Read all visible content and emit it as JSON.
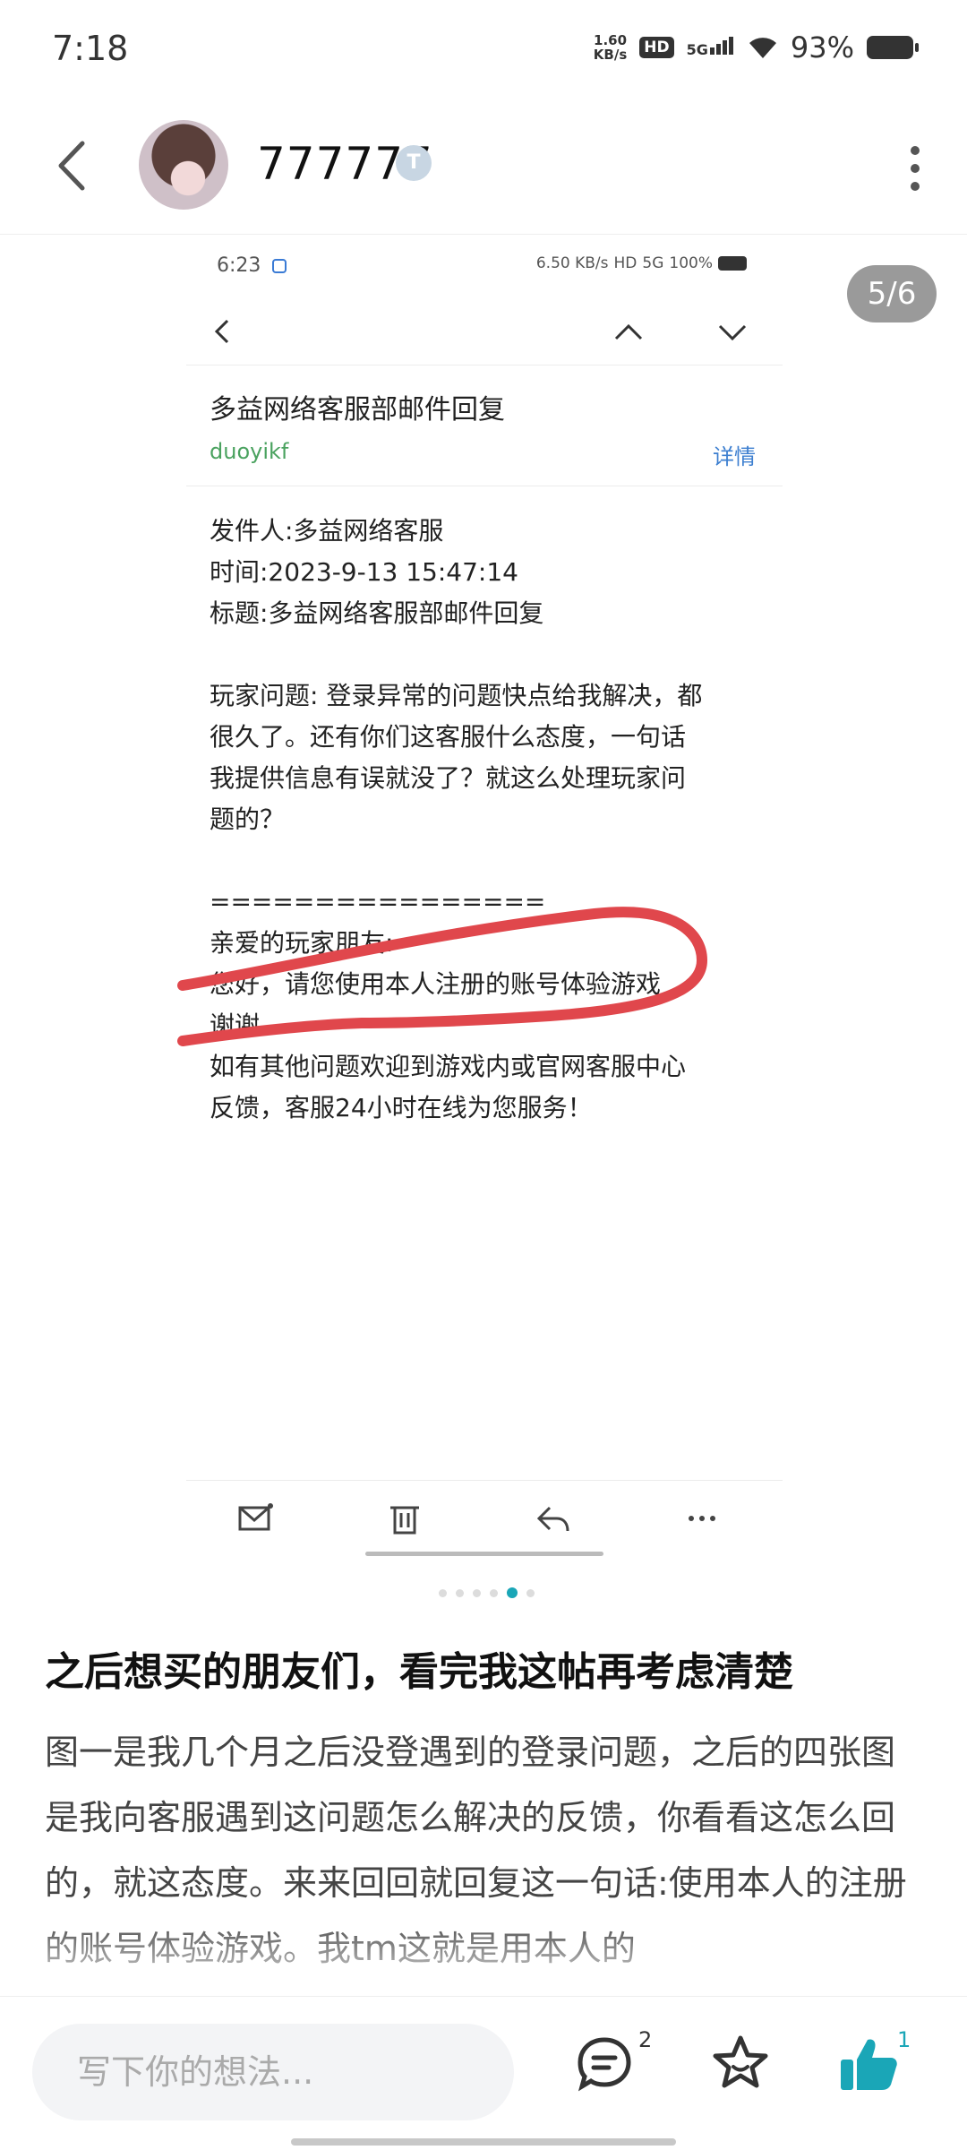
{
  "status_bar": {
    "time": "7:18",
    "speed_value": "1.60",
    "speed_unit": "KB/s",
    "hd": "HD",
    "network": "5G",
    "battery": "93%"
  },
  "header": {
    "username": "777777",
    "level_badge": "T"
  },
  "page_counter": "5/6",
  "embedded": {
    "status": {
      "time": "6:23",
      "speed": "6.50 KB/s",
      "hd": "HD",
      "network": "5G",
      "battery": "100%"
    },
    "mail": {
      "subject": "多益网络客服部邮件回复",
      "sender": "duoyikf",
      "detail_link": "详情",
      "lines": [
        "发件人:多益网络客服",
        "时间:2023-9-13 15:47:14",
        "标题:多益网络客服部邮件回复",
        "",
        "玩家问题: 登录异常的问题快点给我解决，都",
        "很久了。还有你们这客服什么态度，一句话",
        "我提供信息有误就没了？就这么处理玩家问",
        "题的？",
        "",
        "================",
        "亲爱的玩家朋友:",
        "您好，请您使用本人注册的账号体验游戏",
        "谢谢。",
        "如有其他问题欢迎到游戏内或官网客服中心",
        "反馈，客服24小时在线为您服务！"
      ]
    },
    "highlight_color": "#e0474c"
  },
  "carousel": {
    "total": 6,
    "active_index": 4
  },
  "post": {
    "title": "之后想买的朋友们，看完我这帖再考虑清楚",
    "body": "图一是我几个月之后没登遇到的登录问题，之后的四张图是我向客服遇到这问题怎么解决的反馈，你看看这怎么回的，就这态度。来来回回就回复这一句话:使用本人的注册的账号体验游戏。我tm这就是用本人的"
  },
  "bottom_bar": {
    "comment_placeholder": "写下你的想法...",
    "comment_count": "2",
    "like_count": "1",
    "accent_color": "#1aa6b7"
  }
}
